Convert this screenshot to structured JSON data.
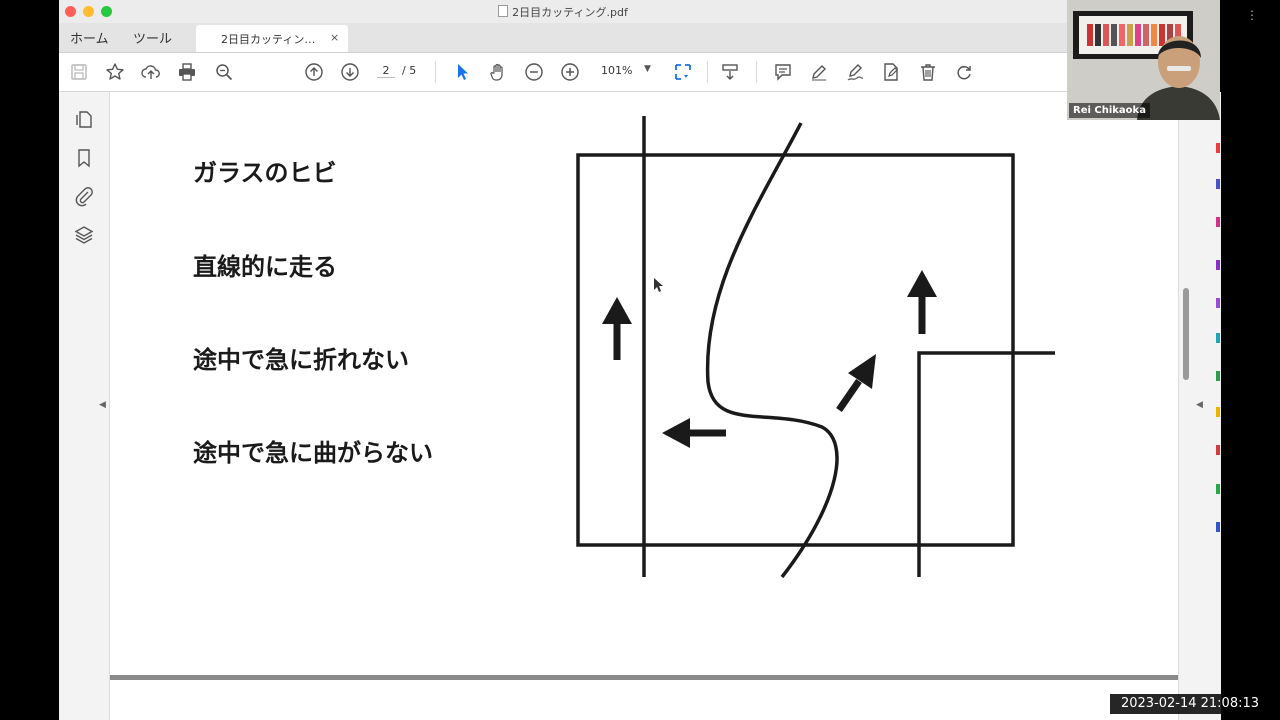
{
  "window": {
    "title": "2日目カッティング.pdf",
    "traffic_colors": [
      "#ff5f57",
      "#febc2e",
      "#28c840"
    ]
  },
  "tabs": {
    "home": "ホーム",
    "tools": "ツール",
    "document": "2日目カッティン…",
    "close": "×"
  },
  "toolbar": {
    "icons": [
      "save-icon",
      "bookmark-star-icon",
      "cloud-upload-icon",
      "print-icon",
      "zoom-search-icon",
      "page-up-icon",
      "page-down-icon",
      "select-arrow-icon",
      "hand-icon",
      "zoom-out-icon",
      "zoom-in-icon",
      "fit-page-icon",
      "scroll-mode-icon",
      "comment-icon",
      "highlight-pen-icon",
      "sign-icon",
      "edit-pdf-icon",
      "delete-icon",
      "rotate-icon"
    ],
    "current_page": "2",
    "page_total": "/ 5",
    "zoom": "101%",
    "accent": "#1a73e8"
  },
  "slide": {
    "lines": [
      "ガラスのヒビ",
      "直線的に走る",
      "途中で急に折れない",
      "途中で急に曲がらない"
    ]
  },
  "webcam": {
    "name": "Rei Chikaoka"
  },
  "timestamp": "2023-02-14  21:08:13"
}
